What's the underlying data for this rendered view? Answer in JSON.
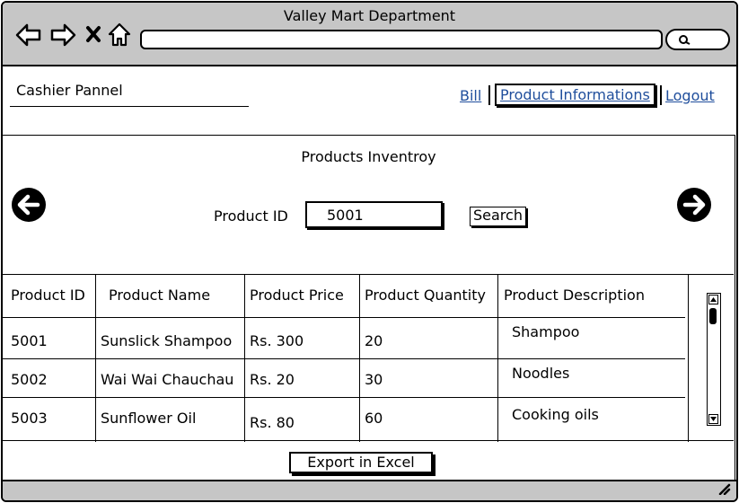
{
  "window": {
    "title": "Valley Mart Department"
  },
  "browser": {
    "back_icon": "arrow-left-outline-icon",
    "forward_icon": "arrow-right-outline-icon",
    "stop_icon": "x-icon",
    "home_icon": "home-icon",
    "url": "",
    "search_icon": "magnifier-icon"
  },
  "header": {
    "panel_title": "Cashier Pannel",
    "nav": [
      {
        "label": "Bill",
        "active": false
      },
      {
        "label": "Product Informations",
        "active": true
      },
      {
        "label": "Logout",
        "active": false
      }
    ]
  },
  "inventory": {
    "title": "Products Inventroy",
    "prev_icon": "circle-arrow-left-icon",
    "next_icon": "circle-arrow-right-icon",
    "product_id_label": "Product ID",
    "product_id_value": "5001",
    "search_label": "Search"
  },
  "table": {
    "columns": [
      "Product ID",
      "Product Name",
      "Product Price",
      "Product Quantity",
      "Product Description"
    ],
    "rows": [
      [
        "5001",
        "Sunslick Shampoo",
        "Rs. 300",
        "20",
        "Shampoo"
      ],
      [
        "5002",
        "Wai Wai Chauchau",
        "Rs. 20",
        "30",
        "Noodles"
      ],
      [
        "5003",
        "Sunflower Oil",
        "Rs. 80",
        "60",
        "Cooking oils"
      ]
    ]
  },
  "export_label": "Export in Excel",
  "colors": {
    "chrome": "#c6c6c6",
    "link": "#1f4e9c"
  }
}
